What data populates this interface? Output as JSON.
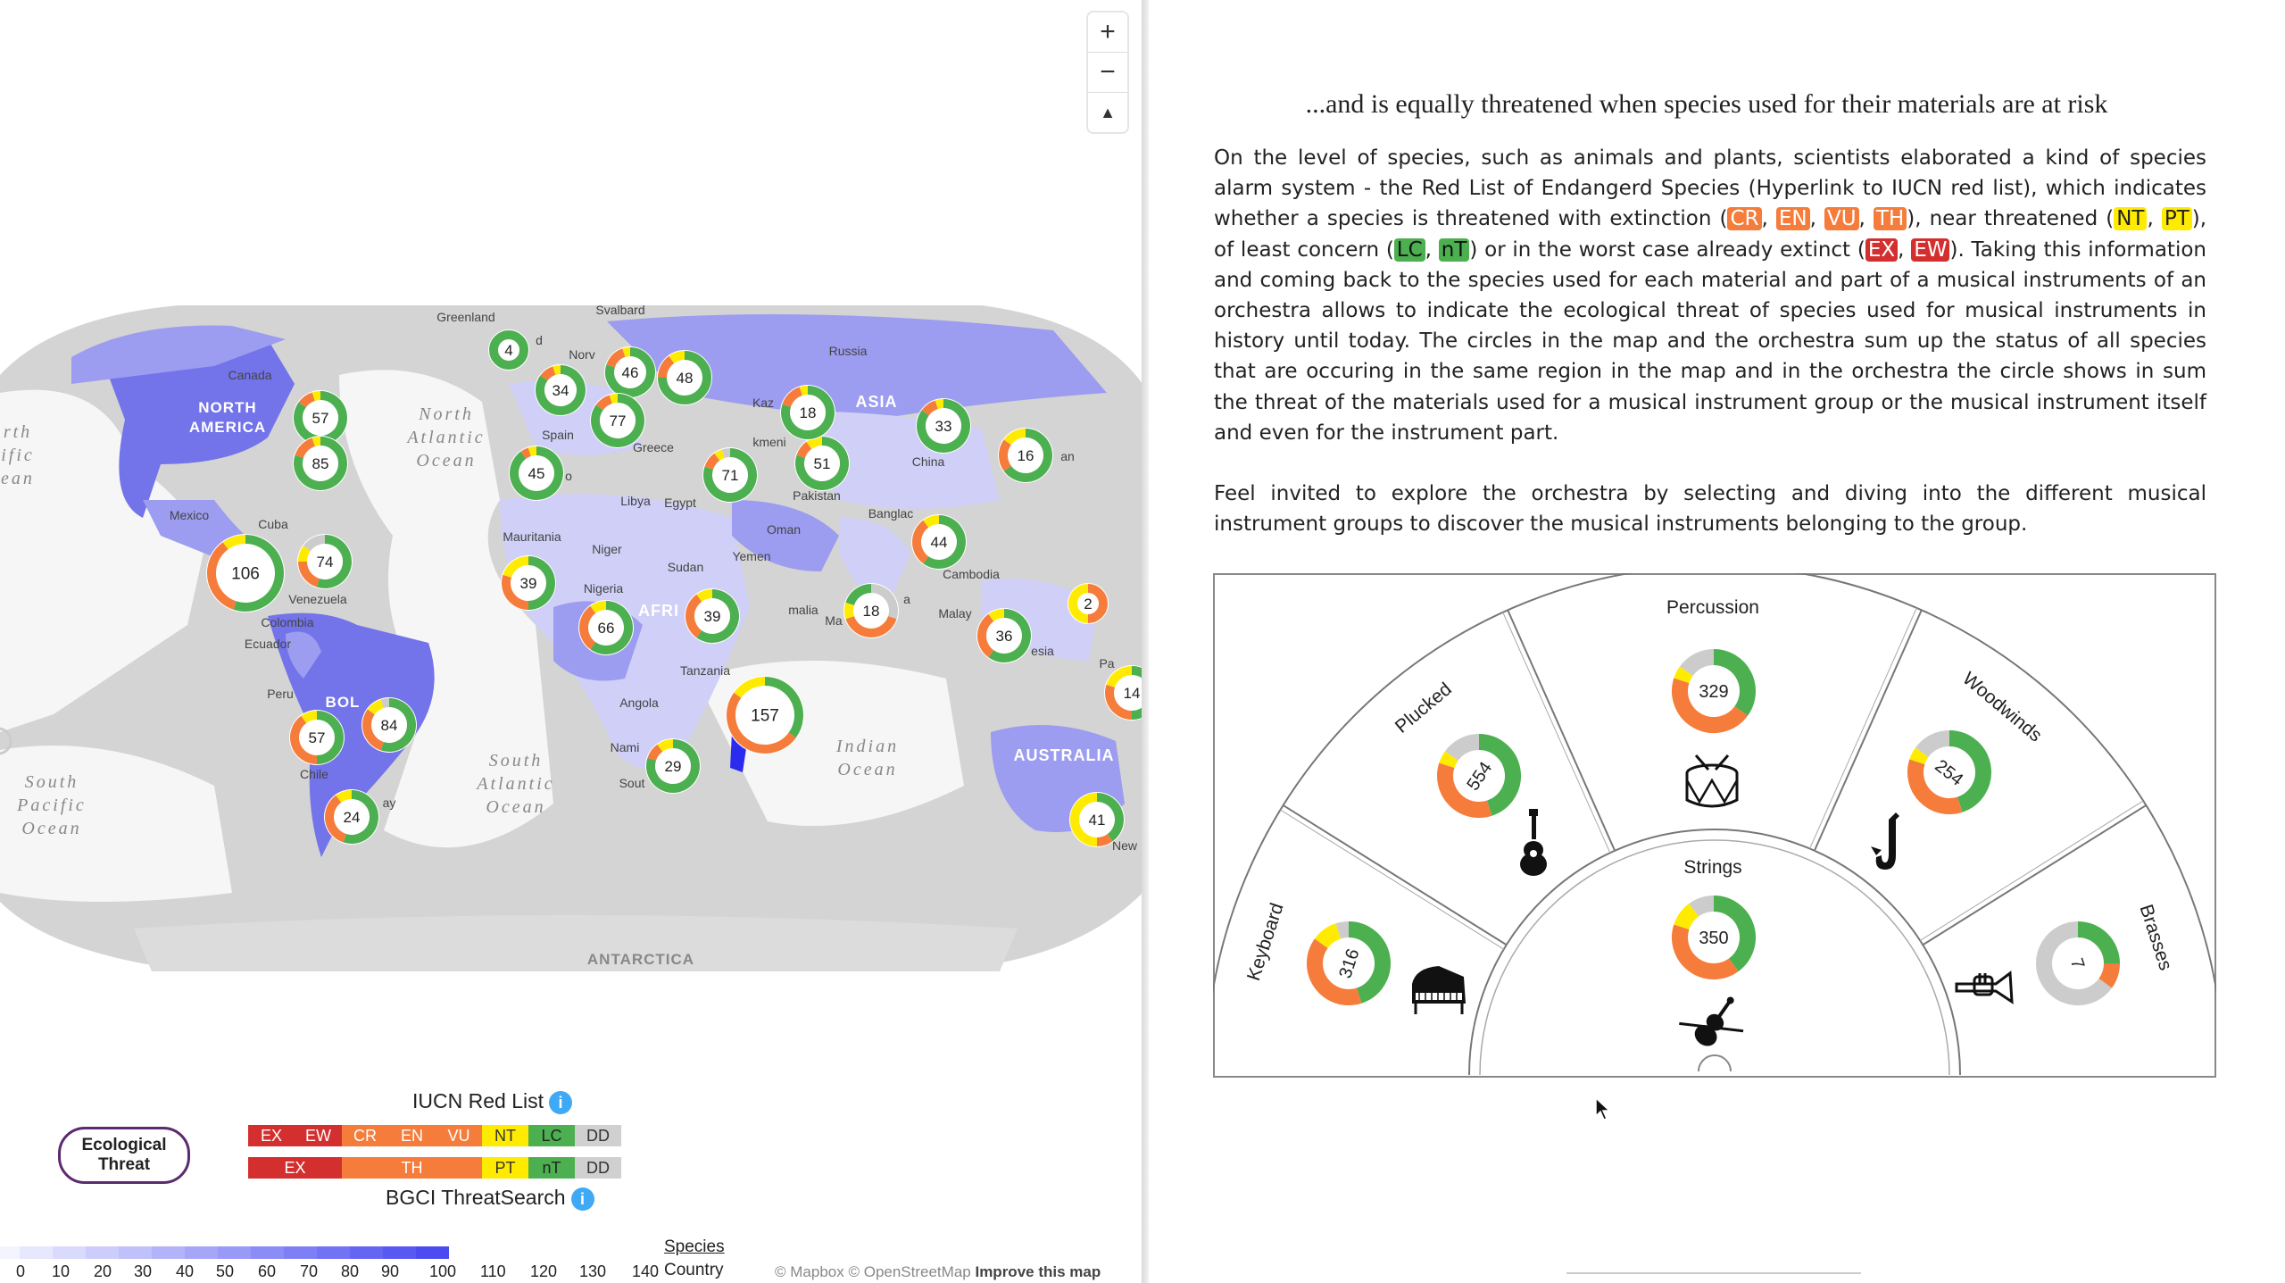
{
  "map": {
    "zoom_in_label": "+",
    "zoom_out_label": "−",
    "compass_label": "▲",
    "colors": {
      "land_base": "#d4d4d4",
      "ocean": "#ffffff",
      "choropleth_light": "#cfcff7",
      "choropleth_mid": "#9c9cf0",
      "choropleth_dark": "#7373ea",
      "antarctica": "#dcdcdc"
    },
    "place_labels": [
      {
        "text": "Greenland"
      },
      {
        "text": "Svalbard"
      },
      {
        "text": "Canada"
      },
      {
        "text": "NORTH"
      },
      {
        "text": "AMERICA"
      },
      {
        "text": "North"
      },
      {
        "text": "Atlantic"
      },
      {
        "text": "Ocean"
      },
      {
        "text": "Spain"
      },
      {
        "text": "Norv"
      },
      {
        "text": "Russia"
      },
      {
        "text": "Kaz"
      },
      {
        "text": "kmeni"
      },
      {
        "text": "ASIA"
      },
      {
        "text": "Greece"
      },
      {
        "text": "China"
      },
      {
        "text": "an"
      },
      {
        "text": "Libya"
      },
      {
        "text": "Egypt"
      },
      {
        "text": "Oman"
      },
      {
        "text": "Pakistan"
      },
      {
        "text": "Banglac"
      },
      {
        "text": "Mexico"
      },
      {
        "text": "Cuba"
      },
      {
        "text": "Mauritania"
      },
      {
        "text": "Niger"
      },
      {
        "text": "Sudan"
      },
      {
        "text": "Yemen"
      },
      {
        "text": "Venezuela"
      },
      {
        "text": "Nigeria"
      },
      {
        "text": "AFRI"
      },
      {
        "text": "malia"
      },
      {
        "text": "Colombia"
      },
      {
        "text": "Ecuador"
      },
      {
        "text": "Cambodia"
      },
      {
        "text": "Malay"
      },
      {
        "text": "esia"
      },
      {
        "text": "Tanzania"
      },
      {
        "text": "Peru"
      },
      {
        "text": "Angola"
      },
      {
        "text": "Nami"
      },
      {
        "text": "Sout"
      },
      {
        "text": "Ma"
      },
      {
        "text": "Mad"
      },
      {
        "text": "Indian"
      },
      {
        "text": "Ocean"
      },
      {
        "text": "AUSTRALIA"
      },
      {
        "text": "Pa"
      },
      {
        "text": "New"
      },
      {
        "text": "Chile"
      },
      {
        "text": "ay"
      },
      {
        "text": "South"
      },
      {
        "text": "Atlantic"
      },
      {
        "text": "Ocean"
      },
      {
        "text": "South"
      },
      {
        "text": "Pacific"
      },
      {
        "text": "Ocean"
      },
      {
        "text": "rth"
      },
      {
        "text": "ific"
      },
      {
        "text": "ean"
      },
      {
        "text": "ANTARCTICA"
      },
      {
        "text": "a"
      },
      {
        "text": "d"
      },
      {
        "text": "o"
      },
      {
        "text": "BOL"
      }
    ],
    "clusters": [
      {
        "label": "4",
        "segments": [
          {
            "color": "#4caf50",
            "value": 1
          }
        ]
      },
      {
        "label": "34",
        "segments": [
          {
            "color": "#4caf50",
            "value": 0.85
          },
          {
            "color": "#f57c3b",
            "value": 0.1
          },
          {
            "color": "#ffeb00",
            "value": 0.05
          }
        ]
      },
      {
        "label": "46",
        "segments": [
          {
            "color": "#4caf50",
            "value": 0.8
          },
          {
            "color": "#f57c3b",
            "value": 0.15
          },
          {
            "color": "#ffeb00",
            "value": 0.05
          }
        ]
      },
      {
        "label": "48",
        "segments": [
          {
            "color": "#4caf50",
            "value": 0.75
          },
          {
            "color": "#f57c3b",
            "value": 0.15
          },
          {
            "color": "#ffeb00",
            "value": 0.1
          }
        ]
      },
      {
        "label": "77",
        "segments": [
          {
            "color": "#4caf50",
            "value": 0.85
          },
          {
            "color": "#f57c3b",
            "value": 0.1
          },
          {
            "color": "#ffeb00",
            "value": 0.05
          }
        ]
      },
      {
        "label": "57",
        "segments": [
          {
            "color": "#4caf50",
            "value": 0.85
          },
          {
            "color": "#f57c3b",
            "value": 0.1
          },
          {
            "color": "#ffeb00",
            "value": 0.05
          }
        ]
      },
      {
        "label": "85",
        "segments": [
          {
            "color": "#4caf50",
            "value": 0.8
          },
          {
            "color": "#f57c3b",
            "value": 0.15
          },
          {
            "color": "#ffeb00",
            "value": 0.05
          }
        ]
      },
      {
        "label": "45",
        "segments": [
          {
            "color": "#4caf50",
            "value": 0.9
          },
          {
            "color": "#f57c3b",
            "value": 0.05
          },
          {
            "color": "#ffeb00",
            "value": 0.05
          }
        ]
      },
      {
        "label": "71",
        "segments": [
          {
            "color": "#4caf50",
            "value": 0.8
          },
          {
            "color": "#f57c3b",
            "value": 0.1
          },
          {
            "color": "#ffeb00",
            "value": 0.05
          },
          {
            "color": "#cccccc",
            "value": 0.05
          }
        ]
      },
      {
        "label": "51",
        "segments": [
          {
            "color": "#4caf50",
            "value": 0.8
          },
          {
            "color": "#f57c3b",
            "value": 0.1
          },
          {
            "color": "#ffeb00",
            "value": 0.1
          }
        ]
      },
      {
        "label": "18",
        "segments": [
          {
            "color": "#4caf50",
            "value": 0.8
          },
          {
            "color": "#f57c3b",
            "value": 0.15
          },
          {
            "color": "#ffeb00",
            "value": 0.05
          }
        ]
      },
      {
        "label": "33",
        "segments": [
          {
            "color": "#4caf50",
            "value": 0.85
          },
          {
            "color": "#f57c3b",
            "value": 0.1
          },
          {
            "color": "#ffeb00",
            "value": 0.05
          }
        ]
      },
      {
        "label": "16",
        "segments": [
          {
            "color": "#4caf50",
            "value": 0.65
          },
          {
            "color": "#f57c3b",
            "value": 0.2
          },
          {
            "color": "#ffeb00",
            "value": 0.15
          }
        ]
      },
      {
        "label": "106",
        "segments": [
          {
            "color": "#4caf50",
            "value": 0.55
          },
          {
            "color": "#f57c3b",
            "value": 0.35
          },
          {
            "color": "#ffeb00",
            "value": 0.1
          }
        ]
      },
      {
        "label": "74",
        "segments": [
          {
            "color": "#4caf50",
            "value": 0.55
          },
          {
            "color": "#f57c3b",
            "value": 0.2
          },
          {
            "color": "#ffeb00",
            "value": 0.1
          },
          {
            "color": "#cccccc",
            "value": 0.15
          }
        ]
      },
      {
        "label": "39",
        "segments": [
          {
            "color": "#4caf50",
            "value": 0.5
          },
          {
            "color": "#f57c3b",
            "value": 0.3
          },
          {
            "color": "#ffeb00",
            "value": 0.2
          }
        ]
      },
      {
        "label": "66",
        "segments": [
          {
            "color": "#4caf50",
            "value": 0.6
          },
          {
            "color": "#f57c3b",
            "value": 0.3
          },
          {
            "color": "#ffeb00",
            "value": 0.1
          }
        ]
      },
      {
        "label": "39",
        "segments": [
          {
            "color": "#4caf50",
            "value": 0.6
          },
          {
            "color": "#f57c3b",
            "value": 0.3
          },
          {
            "color": "#ffeb00",
            "value": 0.1
          }
        ]
      },
      {
        "label": "44",
        "segments": [
          {
            "color": "#4caf50",
            "value": 0.6
          },
          {
            "color": "#f57c3b",
            "value": 0.3
          },
          {
            "color": "#ffeb00",
            "value": 0.1
          }
        ]
      },
      {
        "label": "18",
        "segments": [
          {
            "color": "#cccccc",
            "value": 0.3
          },
          {
            "color": "#f57c3b",
            "value": 0.4
          },
          {
            "color": "#ffeb00",
            "value": 0.1
          },
          {
            "color": "#4caf50",
            "value": 0.2
          }
        ]
      },
      {
        "label": "36",
        "segments": [
          {
            "color": "#4caf50",
            "value": 0.6
          },
          {
            "color": "#f57c3b",
            "value": 0.3
          },
          {
            "color": "#ffeb00",
            "value": 0.1
          }
        ]
      },
      {
        "label": "2",
        "segments": [
          {
            "color": "#f57c3b",
            "value": 0.5
          },
          {
            "color": "#ffeb00",
            "value": 0.5
          }
        ]
      },
      {
        "label": "14",
        "segments": [
          {
            "color": "#4caf50",
            "value": 0.5
          },
          {
            "color": "#f57c3b",
            "value": 0.3
          },
          {
            "color": "#ffeb00",
            "value": 0.2
          }
        ]
      },
      {
        "label": "157",
        "segments": [
          {
            "color": "#4caf50",
            "value": 0.35
          },
          {
            "color": "#f57c3b",
            "value": 0.5
          },
          {
            "color": "#ffeb00",
            "value": 0.15
          }
        ]
      },
      {
        "label": "29",
        "segments": [
          {
            "color": "#4caf50",
            "value": 0.8
          },
          {
            "color": "#f57c3b",
            "value": 0.1
          },
          {
            "color": "#ffeb00",
            "value": 0.1
          }
        ]
      },
      {
        "label": "57",
        "segments": [
          {
            "color": "#4caf50",
            "value": 0.5
          },
          {
            "color": "#f57c3b",
            "value": 0.4
          },
          {
            "color": "#ffeb00",
            "value": 0.1
          }
        ]
      },
      {
        "label": "84",
        "segments": [
          {
            "color": "#4caf50",
            "value": 0.55
          },
          {
            "color": "#f57c3b",
            "value": 0.3
          },
          {
            "color": "#ffeb00",
            "value": 0.1
          },
          {
            "color": "#cccccc",
            "value": 0.05
          }
        ]
      },
      {
        "label": "24",
        "segments": [
          {
            "color": "#4caf50",
            "value": 0.55
          },
          {
            "color": "#f57c3b",
            "value": 0.35
          },
          {
            "color": "#ffeb00",
            "value": 0.1
          }
        ]
      },
      {
        "label": "41",
        "segments": [
          {
            "color": "#4caf50",
            "value": 0.4
          },
          {
            "color": "#f57c3b",
            "value": 0.1
          },
          {
            "color": "#ffeb00",
            "value": 0.5
          }
        ]
      }
    ]
  },
  "legend": {
    "iucn_title": "IUCN Red List",
    "bgci_title": "BGCI ThreatSearch",
    "info_icon": "i",
    "eco_line1": "Ecological",
    "eco_line2": "Threat",
    "iucn_cells": [
      {
        "text": "EX",
        "color": "#d32f2f"
      },
      {
        "text": "EW",
        "color": "#d32f2f"
      },
      {
        "text": "CR",
        "color": "#f57c3b"
      },
      {
        "text": "EN",
        "color": "#f57c3b"
      },
      {
        "text": "VU",
        "color": "#f57c3b"
      },
      {
        "text": "NT",
        "color": "#ffeb00"
      },
      {
        "text": "LC",
        "color": "#4caf50"
      },
      {
        "text": "DD",
        "color": "#d0d0d0"
      }
    ],
    "bgci_cells": [
      {
        "text": "EX",
        "color": "#d32f2f"
      },
      {
        "text": "TH",
        "color": "#f57c3b"
      },
      {
        "text": "PT",
        "color": "#ffeb00"
      },
      {
        "text": "nT",
        "color": "#4caf50"
      },
      {
        "text": "DD",
        "color": "#d0d0d0"
      }
    ],
    "scale_colors": [
      "#f4f4fe",
      "#e7e7fd",
      "#dadafc",
      "#cdcdfb",
      "#c0c0fa",
      "#b3b3f9",
      "#a6a6f8",
      "#9999f7",
      "#8c8cf6",
      "#7f7ff5",
      "#7272f4",
      "#6565f3",
      "#5858f2",
      "#4b4bf1"
    ],
    "scale_labels": [
      "0",
      "10",
      "20",
      "30",
      "40",
      "50",
      "60",
      "70",
      "80",
      "90",
      "100",
      "110",
      "120",
      "130",
      "140"
    ],
    "species_label": "Species",
    "country_label": "Country"
  },
  "attribution": {
    "mapbox": "© Mapbox",
    "osm": "© OpenStreetMap",
    "improve": "Improve this map"
  },
  "article": {
    "heading": "...and is equally threatened when species used for their materials are at risk",
    "p1_a": "On the level of species, such as animals and plants, scientists elaborated a kind of species alarm system - the Red List of Endangerd Species (Hyperlink to IUCN red list), which indicates whether a species is threatened with extinction (",
    "tag_cr": "CR",
    "tag_en": "EN",
    "tag_vu": "VU",
    "tag_th": "TH",
    "p1_b": "), near threatened (",
    "tag_nt": "NT",
    "tag_pt": "PT",
    "p1_c": "), of least concern (",
    "tag_lc": "LC",
    "tag_nt2": "nT",
    "p1_d": ") or in the worst case already extinct (",
    "tag_ex": "EX",
    "tag_ew": "EW",
    "p1_e": "). Taking this information and coming back to the species used for each material and part of a musical instruments of an orchestra allows to indicate the ecological threat of species used for musical instruments in history until today. The circles in the map and the orchestra sum up the status of all species that are occuring in the same region in the map and in the orchestra the circle shows in sum the threat of the materials used for a musical instrument group or the musical instrument itself and even for the instrument part.",
    "p2": "Feel invited to explore the orchestra by selecting and diving into the different musical instrument groups to discover the musical instruments belonging to the group.",
    "comma": ", "
  },
  "orchestra": {
    "groups": [
      {
        "name": "Keyboard",
        "count": "316",
        "icon": "piano-icon"
      },
      {
        "name": "Plucked",
        "count": "554",
        "icon": "guitar-icon"
      },
      {
        "name": "Percussion",
        "count": "329",
        "icon": "drum-icon"
      },
      {
        "name": "Woodwinds",
        "count": "254",
        "icon": "saxophone-icon"
      },
      {
        "name": "Brasses",
        "count": "7",
        "icon": "trumpet-icon"
      },
      {
        "name": "Strings",
        "count": "350",
        "icon": "violin-icon"
      }
    ],
    "donuts": [
      {
        "segments": [
          {
            "color": "#4caf50",
            "value": 0.45
          },
          {
            "color": "#f57c3b",
            "value": 0.4
          },
          {
            "color": "#ffeb00",
            "value": 0.1
          },
          {
            "color": "#cccccc",
            "value": 0.05
          }
        ]
      },
      {
        "segments": [
          {
            "color": "#4caf50",
            "value": 0.45
          },
          {
            "color": "#f57c3b",
            "value": 0.35
          },
          {
            "color": "#ffeb00",
            "value": 0.05
          },
          {
            "color": "#cccccc",
            "value": 0.15
          }
        ]
      },
      {
        "segments": [
          {
            "color": "#4caf50",
            "value": 0.35
          },
          {
            "color": "#f57c3b",
            "value": 0.45
          },
          {
            "color": "#ffeb00",
            "value": 0.05
          },
          {
            "color": "#cccccc",
            "value": 0.15
          }
        ]
      },
      {
        "segments": [
          {
            "color": "#4caf50",
            "value": 0.45
          },
          {
            "color": "#f57c3b",
            "value": 0.35
          },
          {
            "color": "#ffeb00",
            "value": 0.05
          },
          {
            "color": "#cccccc",
            "value": 0.15
          }
        ]
      },
      {
        "segments": [
          {
            "color": "#4caf50",
            "value": 0.25
          },
          {
            "color": "#f57c3b",
            "value": 0.1
          },
          {
            "color": "#cccccc",
            "value": 0.65
          }
        ]
      },
      {
        "segments": [
          {
            "color": "#4caf50",
            "value": 0.4
          },
          {
            "color": "#f57c3b",
            "value": 0.4
          },
          {
            "color": "#ffeb00",
            "value": 0.1
          },
          {
            "color": "#cccccc",
            "value": 0.1
          }
        ]
      }
    ]
  }
}
